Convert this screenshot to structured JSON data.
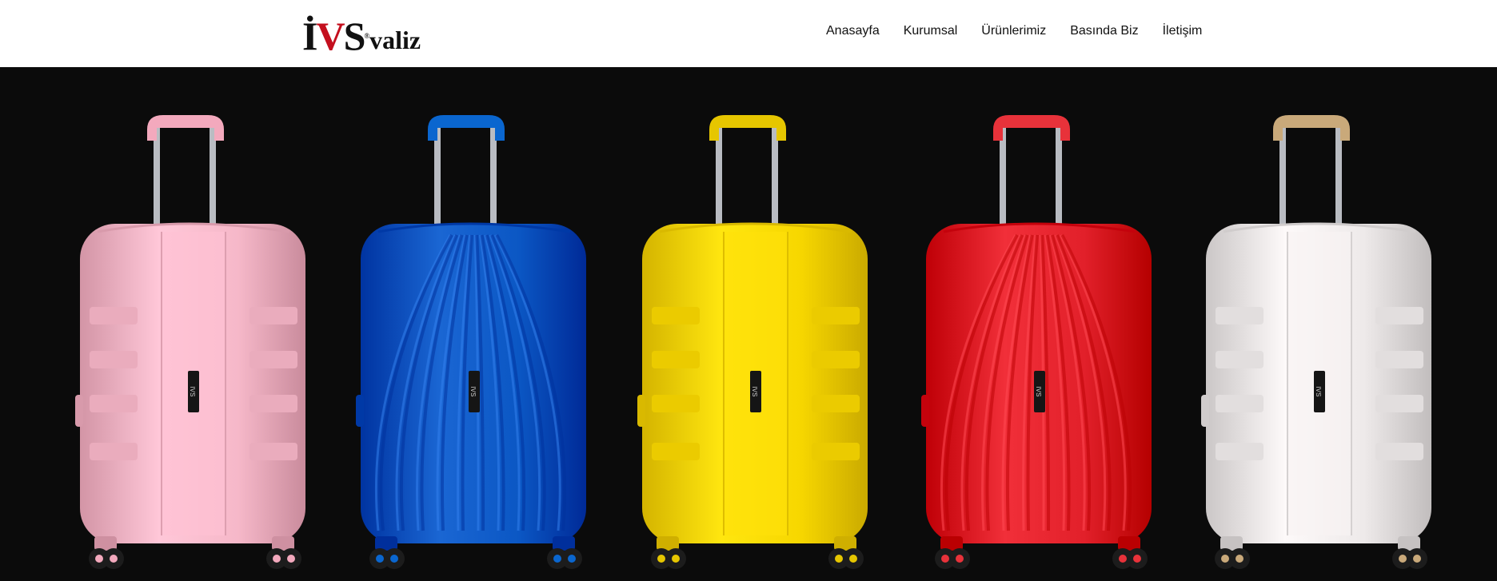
{
  "logo": {
    "letter_i": "İ",
    "letter_v": "V",
    "letter_s": "S",
    "registered": "®",
    "word": "valiz"
  },
  "nav": {
    "items": [
      {
        "label": "Anasayfa"
      },
      {
        "label": "Kurumsal"
      },
      {
        "label": "Ürünlerimiz"
      },
      {
        "label": "Basında Biz"
      },
      {
        "label": "İletişim"
      }
    ]
  },
  "hero": {
    "background": "#0b0b0b",
    "suitcases": [
      {
        "color": "#f6b8c9",
        "handle": "#f3a9bd",
        "style": "ribbed"
      },
      {
        "color": "#0b57c4",
        "handle": "#0a66cf",
        "style": "shell"
      },
      {
        "color": "#f7d700",
        "handle": "#e6c600",
        "style": "ribbed"
      },
      {
        "color": "#e2202a",
        "handle": "#e8323a",
        "style": "shell"
      },
      {
        "color": "#eeeaea",
        "handle": "#c9a97a",
        "style": "ribbed"
      }
    ],
    "badge_text": "IVS"
  },
  "colors": {
    "brand_red": "#c40f1e",
    "text": "#111111"
  }
}
